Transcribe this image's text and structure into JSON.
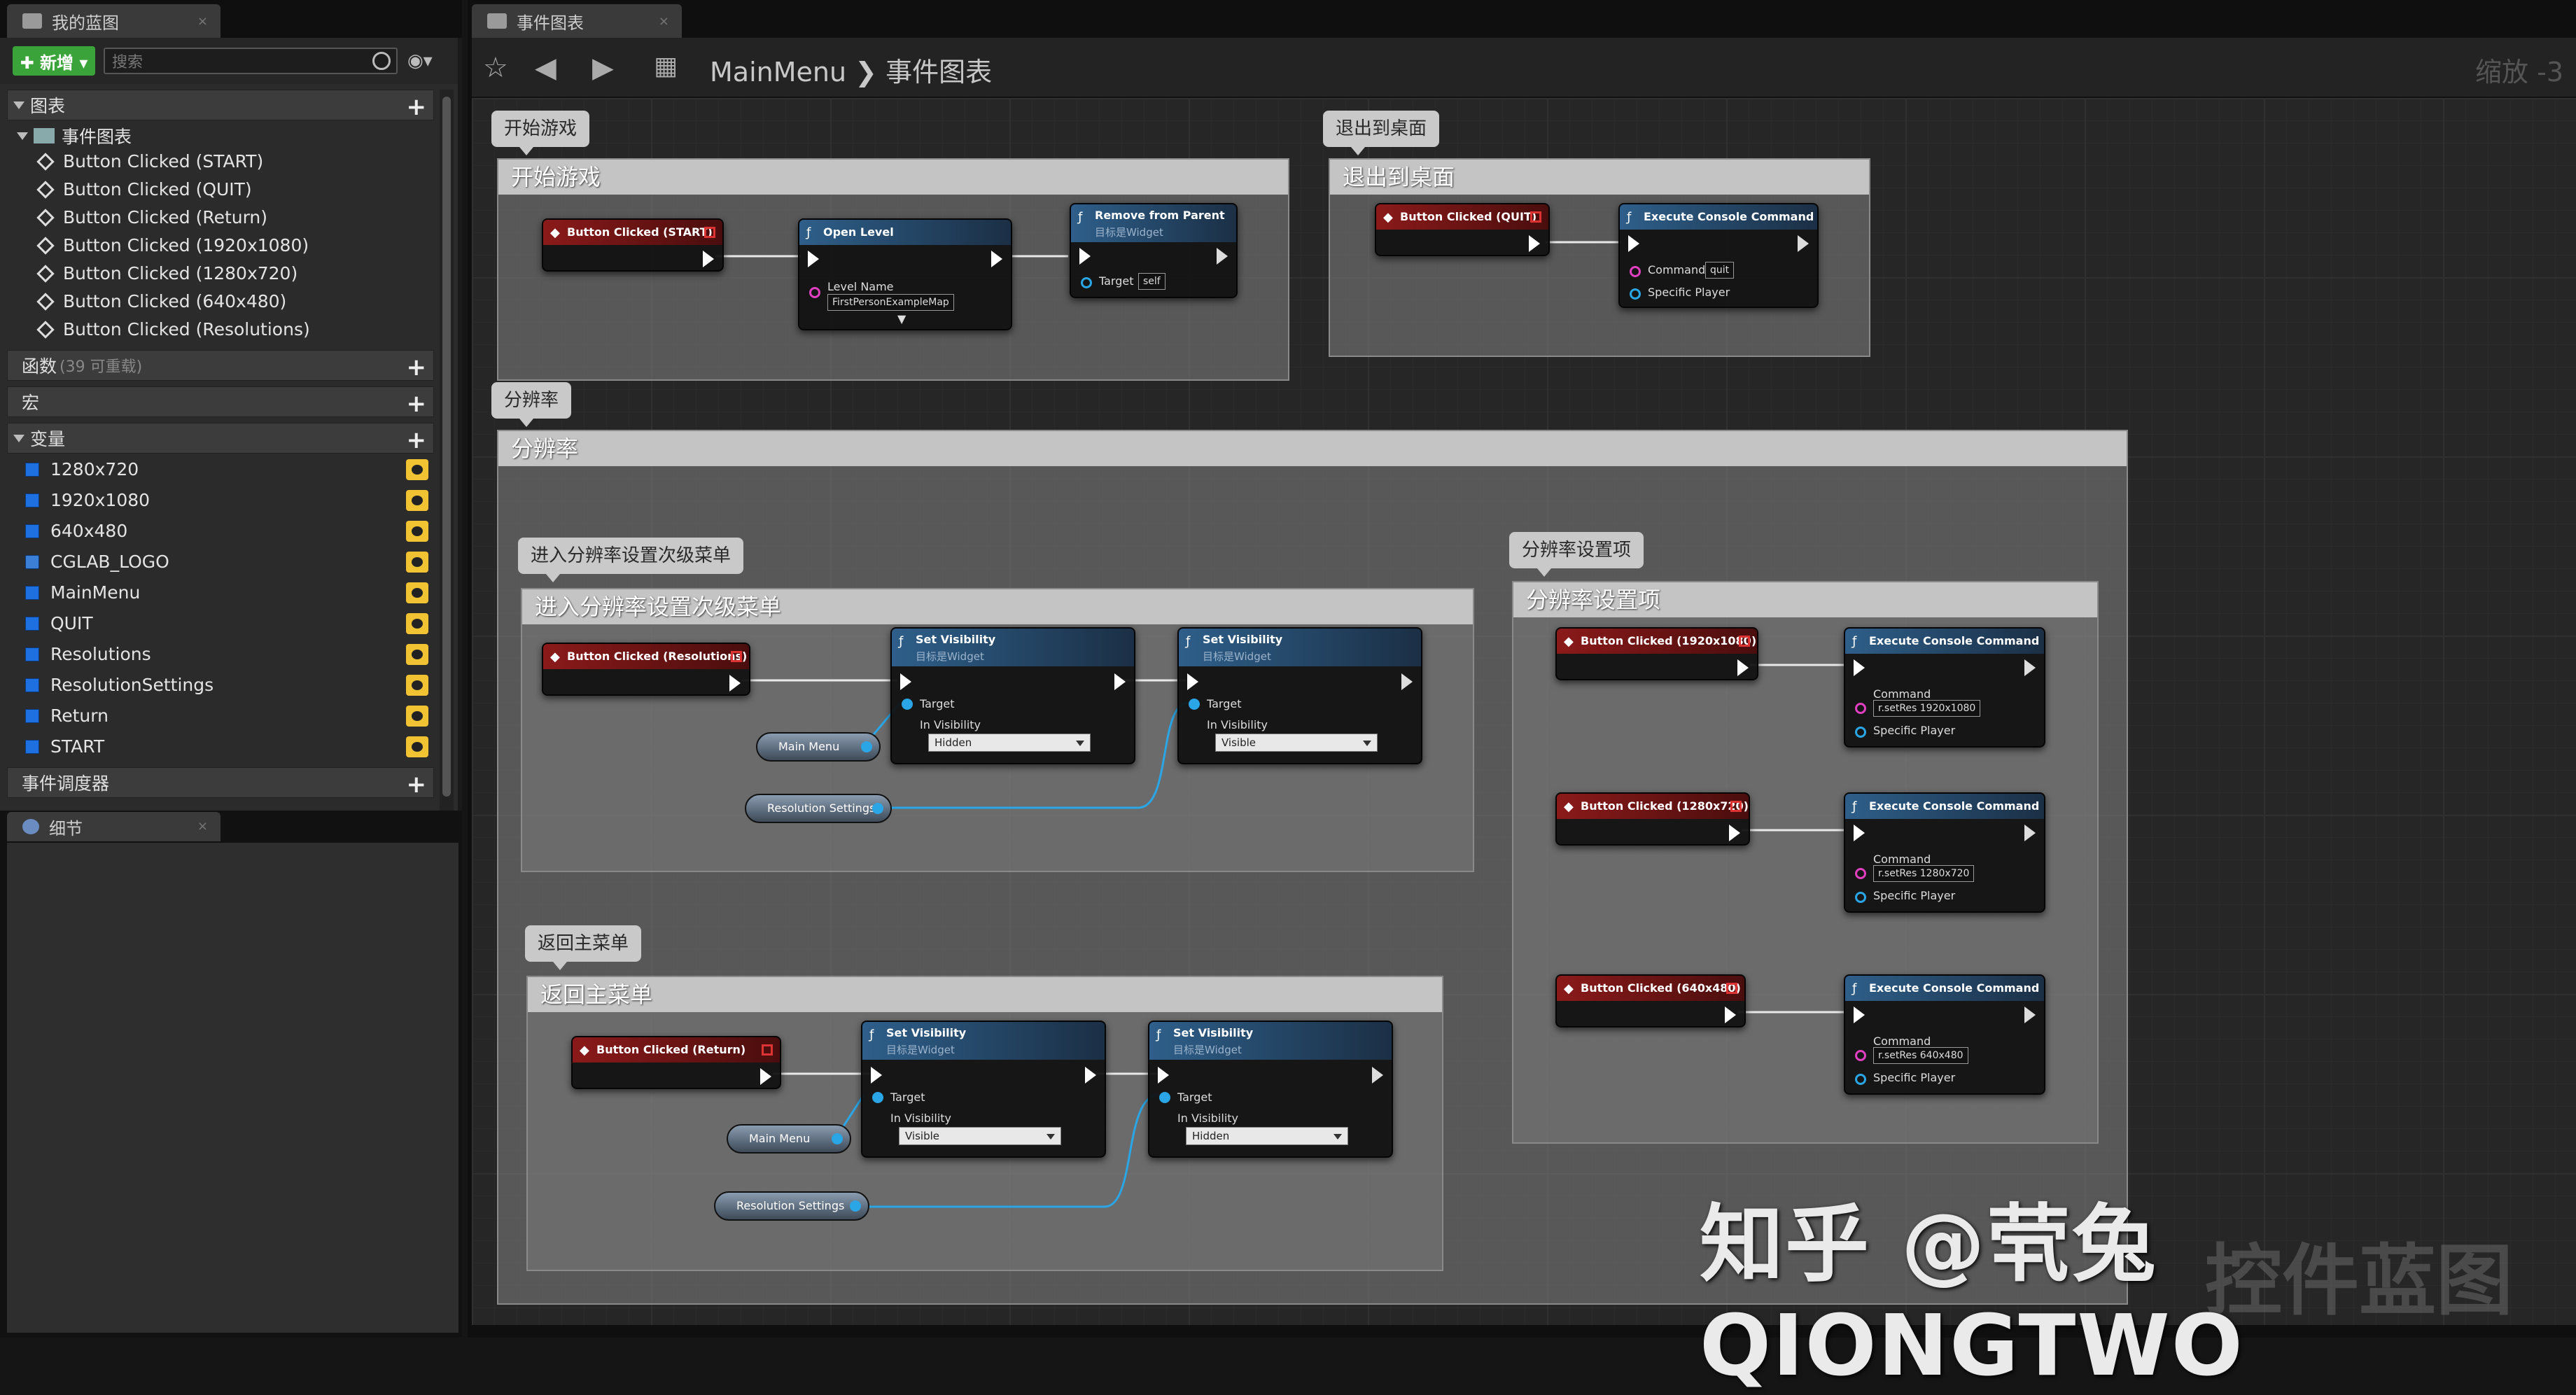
{
  "tabs": {
    "left": "我的蓝图",
    "details": "细节",
    "graph": "事件图表"
  },
  "toolbar": {
    "new_label": "✚ 新增 ▾",
    "search_placeholder": "搜索"
  },
  "sections": {
    "graphs": "图表",
    "event_graph": "事件图表",
    "functions": "函数",
    "functions_sub": "(39 可重载)",
    "macros": "宏",
    "variables": "变量",
    "dispatchers": "事件调度器"
  },
  "events": [
    "Button Clicked (START)",
    "Button Clicked (QUIT)",
    "Button Clicked (Return)",
    "Button Clicked (1920x1080)",
    "Button Clicked (1280x720)",
    "Button Clicked (640x480)",
    "Button Clicked (Resolutions)"
  ],
  "variables": [
    "1280x720",
    "1920x1080",
    "640x480",
    "CGLAB_LOGO",
    "MainMenu",
    "QUIT",
    "Resolutions",
    "ResolutionSettings",
    "Return",
    "START"
  ],
  "breadcrumb": {
    "blueprint": "MainMenu",
    "sep": "❯",
    "graph": "事件图表"
  },
  "zoom": "缩放 -3",
  "comments": {
    "start_bubble": "开始游戏",
    "start_title": "开始游戏",
    "quit_bubble": "退出到桌面",
    "quit_title": "退出到桌面",
    "res_bubble": "分辨率",
    "res_title": "分辨率",
    "sub_bubble": "进入分辨率设置次级菜单",
    "sub_title": "进入分辨率设置次级菜单",
    "opts_bubble": "分辨率设置项",
    "opts_title": "分辨率设置项",
    "back_bubble": "返回主菜单",
    "back_title": "返回主菜单"
  },
  "nodes": {
    "ev_start": "Button Clicked (START)",
    "open_level": "Open Level",
    "level_name_lbl": "Level Name",
    "level_name_val": "FirstPersonExampleMap",
    "remove_parent": "Remove from Parent",
    "target_widget": "目标是Widget",
    "target_lbl": "Target",
    "self_val": "self",
    "ev_quit": "Button Clicked (QUIT)",
    "exec_cmd": "Execute Console Command",
    "command_lbl": "Command",
    "quit_val": "quit",
    "specific_player": "Specific Player",
    "ev_res": "Button Clicked (Resolutions)",
    "set_vis": "Set Visibility",
    "in_vis_lbl": "In Visibility",
    "hidden": "Hidden",
    "visible": "Visible",
    "main_menu": "Main Menu",
    "res_settings": "Resolution Settings",
    "ev_1920": "Button Clicked (1920x1080)",
    "cmd_1920": "r.setRes 1920x1080",
    "ev_1280": "Button Clicked (1280x720)",
    "cmd_1280": "r.setRes 1280x720",
    "ev_640": "Button Clicked (640x480)",
    "cmd_640": "r.setRes 640x480",
    "ev_return": "Button Clicked (Return)"
  },
  "watermark": "知乎 @茕兔QIONGTWO",
  "watermark2": "控件蓝图",
  "colors": {
    "event_header": "#8b1a1a",
    "function_header": "#2e5f8a",
    "object_pin": "#2aa6e6",
    "string_pin": "#e040c0",
    "new_button": "#3aa33a",
    "variable_square": "#1e6fe0"
  }
}
